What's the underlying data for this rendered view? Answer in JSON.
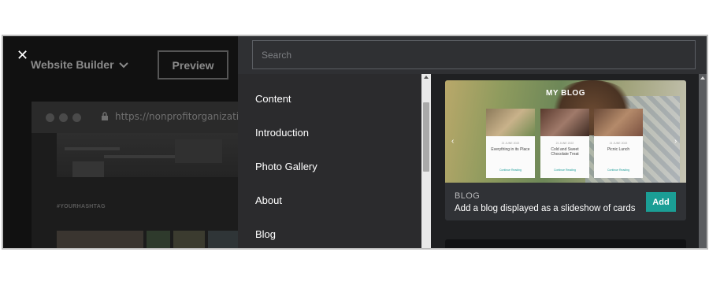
{
  "builder": {
    "close_icon": "close-icon",
    "site_title": "Website Builder",
    "preview_label": "Preview",
    "url": "https://nonprofitorganization",
    "hashtag": "#YOURHASHTAG"
  },
  "search": {
    "placeholder": "Search",
    "value": ""
  },
  "menu": {
    "items": [
      {
        "label": "Content"
      },
      {
        "label": "Introduction"
      },
      {
        "label": "Photo Gallery"
      },
      {
        "label": "About"
      },
      {
        "label": "Blog"
      }
    ]
  },
  "blog_card": {
    "preview_heading": "MY BLOG",
    "posts": [
      {
        "date": "21 JUNE 2022",
        "title": "Everything in its Place",
        "link": "Continue Reading"
      },
      {
        "date": "21 JUNE 2022",
        "title": "Cold and Sweet Chocolate Treat",
        "link": "Continue Reading"
      },
      {
        "date": "21 JUNE 2022",
        "title": "Picnic Lunch",
        "link": "Continue Reading"
      }
    ],
    "type": "BLOG",
    "description": "Add a blog displayed as a slideshow of cards",
    "add_label": "Add"
  },
  "colors": {
    "accent": "#1b9e95",
    "panel_bg": "#2a2a2c",
    "content_bg": "#1f2022"
  }
}
